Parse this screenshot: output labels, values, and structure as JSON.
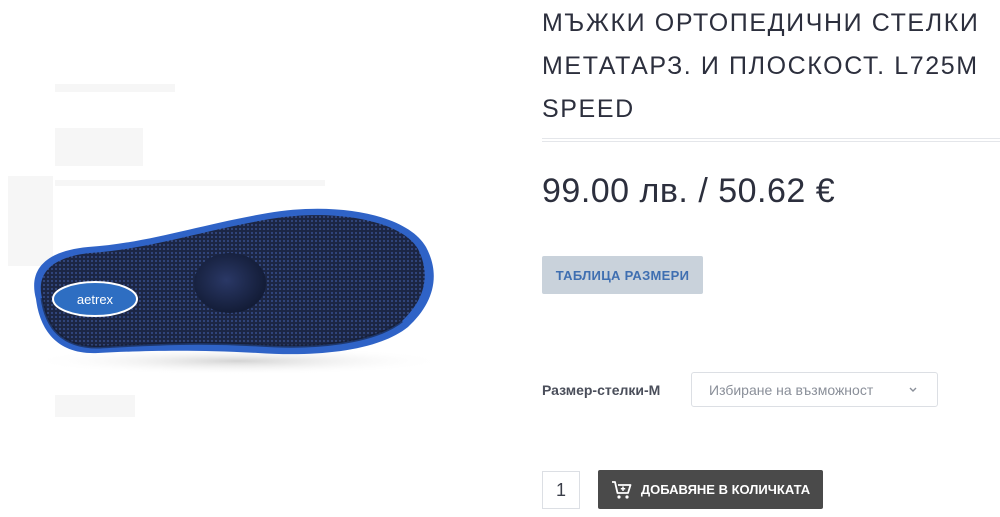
{
  "product": {
    "title": "МЪЖКИ ОРТОПЕДИЧНИ СТЕЛКИ МЕТАТАРЗ. И ПЛОСКОСТ. L725M SPEED",
    "price": "99.00 лв. / 50.62 €",
    "image": {
      "brand": "aetrex",
      "alt": "insole-product-image"
    }
  },
  "buttons": {
    "size_table": "ТАБЛИЦА РАЗМЕРИ",
    "add_to_cart": "ДОБАВЯНЕ В КОЛИЧКАТА"
  },
  "options": {
    "size_label": "Размер-стелки-М",
    "size_placeholder": "Избиране на възможност"
  },
  "quantity": "1",
  "colors": {
    "insole_body": "#1f2a4a",
    "insole_edge": "#2f63c7",
    "logo_oval": "#2e6ec2",
    "size_button_bg": "#c9d2db",
    "size_button_text": "#3f6fb1",
    "cart_button_bg": "#4a4a4a"
  },
  "icons": [
    "cart-icon",
    "chevron-down-icon",
    "aetrex-logo-icon"
  ]
}
